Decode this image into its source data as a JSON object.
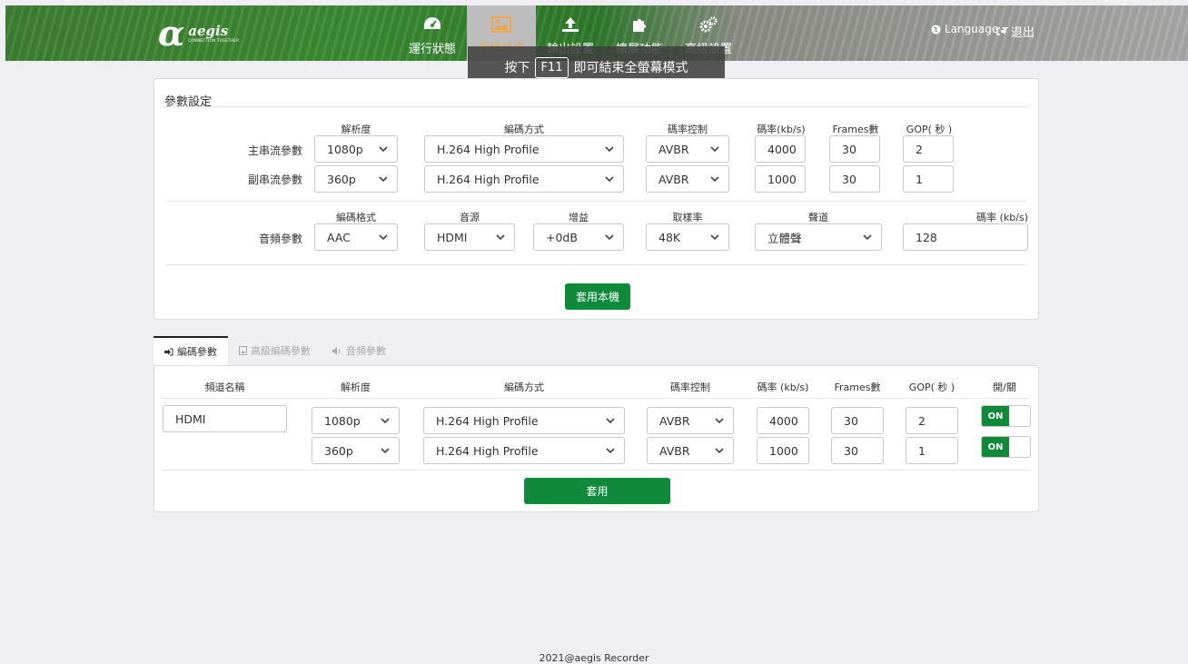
{
  "header": {
    "logo_name": "aegis",
    "logo_tagline": "CONNECTION TOGETHER",
    "nav": [
      {
        "label": "運行狀態",
        "icon": "dashboard-icon"
      },
      {
        "label": "系統設定",
        "icon": "image-icon"
      },
      {
        "label": "輸出設置",
        "icon": "upload-icon"
      },
      {
        "label": "擴展功能",
        "icon": "puzzle-icon"
      },
      {
        "label": "高級設置",
        "icon": "cogs-icon"
      }
    ],
    "language_label": "Language",
    "logout_label": "退出"
  },
  "tooltip": {
    "prefix": "按下",
    "key": "F11",
    "suffix": "即可結束全螢幕模式"
  },
  "param_panel": {
    "title": "參數設定",
    "video_headers": {
      "resolution": "解析度",
      "encoding": "編碼方式",
      "rate_control": "碼率控制",
      "bitrate": "碼率(kb/s)",
      "frames": "Frames數",
      "gop": "GOP( 秒 )"
    },
    "main_stream": {
      "label": "主串流參數",
      "resolution": "1080p",
      "encoding": "H.264 High Profile",
      "rate_control": "AVBR",
      "bitrate": "4000",
      "frames": "30",
      "gop": "2"
    },
    "sub_stream": {
      "label": "副串流參數",
      "resolution": "360p",
      "encoding": "H.264 High Profile",
      "rate_control": "AVBR",
      "bitrate": "1000",
      "frames": "30",
      "gop": "1"
    },
    "audio_headers": {
      "format": "編碼格式",
      "source": "音源",
      "gain": "增益",
      "sample_rate": "取樣率",
      "channel": "聲道",
      "bitrate": "碼率 (kb/s)"
    },
    "audio": {
      "label": "音頻參數",
      "format": "AAC",
      "source": "HDMI",
      "gain": "+0dB",
      "sample_rate": "48K",
      "channel": "立體聲",
      "bitrate": "128"
    },
    "apply_button": "套用本機"
  },
  "tabs": [
    {
      "label": "編碼參數",
      "icon": "sign-in-icon",
      "active": true
    },
    {
      "label": "高級編碼參數",
      "icon": "file-image-icon",
      "active": false
    },
    {
      "label": "音頻參數",
      "icon": "volume-icon",
      "active": false
    }
  ],
  "encode_panel": {
    "headers": {
      "channel_name": "頻道名稱",
      "resolution": "解析度",
      "encoding": "編碼方式",
      "rate_control": "碼率控制",
      "bitrate": "碼率 (kb/s)",
      "frames": "Frames數",
      "gop": "GOP( 秒 )",
      "switch": "開/關"
    },
    "channel_name": "HDMI",
    "rows": [
      {
        "resolution": "1080p",
        "encoding": "H.264 High Profile",
        "rate_control": "AVBR",
        "bitrate": "4000",
        "frames": "30",
        "gop": "2",
        "switch": "ON"
      },
      {
        "resolution": "360p",
        "encoding": "H.264 High Profile",
        "rate_control": "AVBR",
        "bitrate": "1000",
        "frames": "30",
        "gop": "1",
        "switch": "ON"
      }
    ],
    "apply_button": "套用"
  },
  "footer": "2021@aegis Recorder",
  "colors": {
    "accent_green": "#0e8a3a",
    "active_nav_text": "#f0a64a"
  }
}
